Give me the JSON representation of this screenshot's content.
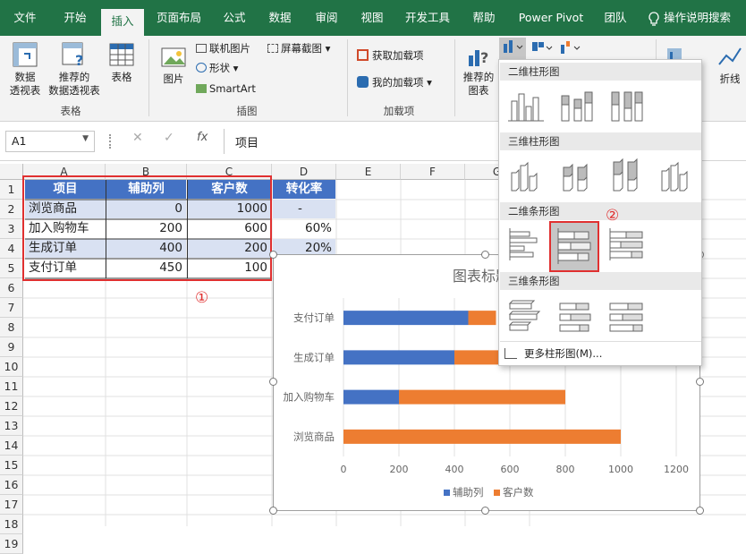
{
  "tabs": {
    "file": "文件",
    "home": "开始",
    "insert": "插入",
    "layout": "页面布局",
    "formula": "公式",
    "data": "数据",
    "review": "审阅",
    "view": "视图",
    "dev": "开发工具",
    "help": "帮助",
    "powerpivot": "Power Pivot",
    "team": "团队",
    "tellme": "操作说明搜索"
  },
  "ribbon": {
    "pivot": "数据\n透视表",
    "recommended_pivot": "推荐的\n数据透视表",
    "table": "表格",
    "group_tables": "表格",
    "picture": "图片",
    "online_picture": "联机图片",
    "shapes": "形状",
    "smartart": "SmartArt",
    "screenshot": "屏幕截图",
    "group_illustrations": "插图",
    "get_addins": "获取加载项",
    "my_addins": "我的加载项",
    "group_addins": "加载项",
    "recommended_charts": "推荐的\n图表",
    "line": "折线"
  },
  "formula_bar": {
    "name_box": "A1",
    "fx": "fx",
    "content": "项目"
  },
  "columns": [
    "A",
    "B",
    "C",
    "D",
    "E",
    "F",
    "G"
  ],
  "rows": [
    "1",
    "2",
    "3",
    "4",
    "5",
    "6",
    "7",
    "8",
    "9",
    "10",
    "11",
    "12",
    "13",
    "14",
    "15",
    "16",
    "17",
    "18",
    "19"
  ],
  "table": {
    "headers": [
      "项目",
      "辅助列",
      "客户数",
      "转化率"
    ],
    "rows": [
      [
        "浏览商品",
        "0",
        "1000",
        "-"
      ],
      [
        "加入购物车",
        "200",
        "600",
        "60%"
      ],
      [
        "生成订单",
        "400",
        "200",
        "20%"
      ],
      [
        "支付订单",
        "450",
        "100",
        ""
      ]
    ]
  },
  "annotations": {
    "one": "①",
    "two": "②"
  },
  "dropdown": {
    "sec1": "二维柱形图",
    "sec2": "三维柱形图",
    "sec3": "二维条形图",
    "sec4": "三维条形图",
    "more": "更多柱形图(M)..."
  },
  "chart_data": {
    "type": "bar",
    "orientation": "horizontal",
    "stacked": true,
    "title": "图表标题",
    "categories": [
      "浏览商品",
      "加入购物车",
      "生成订单",
      "支付订单"
    ],
    "series": [
      {
        "name": "辅助列",
        "values": [
          0,
          200,
          400,
          450
        ],
        "color": "#4472c4"
      },
      {
        "name": "客户数",
        "values": [
          1000,
          600,
          200,
          100
        ],
        "color": "#ed7d31"
      }
    ],
    "xlim": [
      0,
      1200
    ],
    "xticks": [
      "0",
      "200",
      "400",
      "600",
      "800",
      "1000",
      "1200"
    ],
    "legend": "bottom",
    "grid": true
  },
  "colors": {
    "excel_green": "#217346",
    "header_blue": "#4472c4",
    "band": "#d9e1f2",
    "highlight_red": "#e03030"
  }
}
